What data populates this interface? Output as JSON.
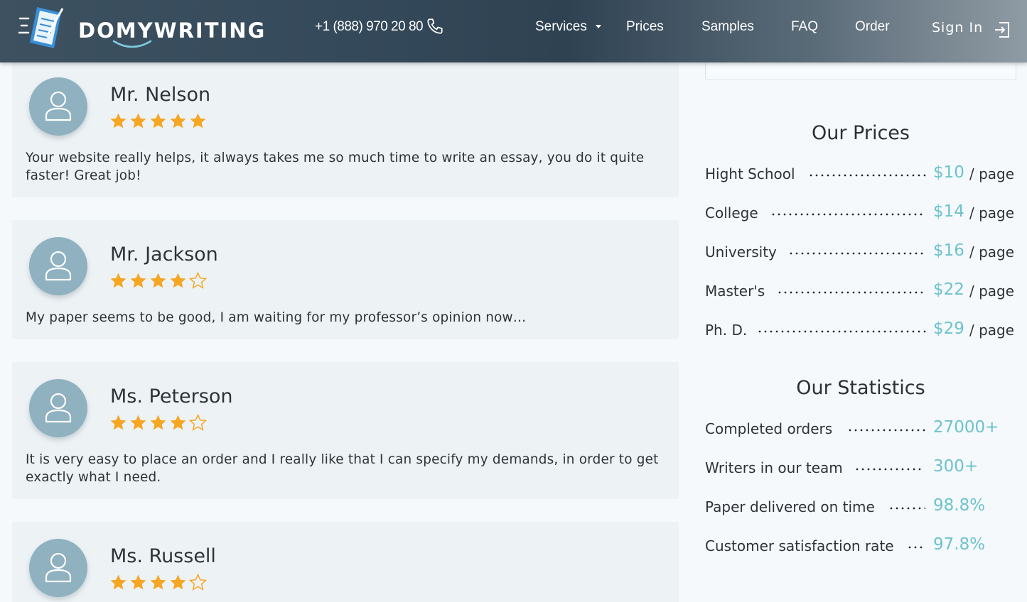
{
  "header": {
    "logo_text": "DOMYWRITING",
    "phone": "+1 (888) 970 20 80",
    "nav": [
      "Services",
      "Prices",
      "Samples",
      "FAQ",
      "Order"
    ],
    "sign_in": "Sign In"
  },
  "reviews": [
    {
      "name": "Mr. Nelson",
      "rating": 5,
      "text": "Your website really helps, it always takes me so much time to write an essay, you do it quite faster! Great job!"
    },
    {
      "name": "Mr. Jackson",
      "rating": 4,
      "text": "My paper seems to be good, I am waiting for my professor’s opinion now…"
    },
    {
      "name": "Ms. Peterson",
      "rating": 4,
      "text": "It is very easy to place an order and I really like that I can specify my demands, in order to get exactly what I need."
    },
    {
      "name": "Ms. Russell",
      "rating": 4,
      "text": ""
    }
  ],
  "prices": {
    "title": "Our Prices",
    "unit": "/ page",
    "rows": [
      {
        "label": "Hight School",
        "value": "$10"
      },
      {
        "label": "College",
        "value": "$14"
      },
      {
        "label": "University",
        "value": "$16"
      },
      {
        "label": "Master's",
        "value": "$22"
      },
      {
        "label": "Ph. D.",
        "value": "$29"
      }
    ]
  },
  "statistics": {
    "title": "Our Statistics",
    "rows": [
      {
        "label": "Completed orders",
        "value": "27000+"
      },
      {
        "label": "Writers in our team",
        "value": "300+"
      },
      {
        "label": "Paper delivered on time",
        "value": "98.8%"
      },
      {
        "label": "Customer satisfaction rate",
        "value": "97.8%"
      }
    ]
  },
  "colors": {
    "accent": "#6cc2cd",
    "star": "#f5a623",
    "avatar": "#8fb1c0",
    "card": "#edf2f5"
  },
  "icons": {
    "logo": "document-pen-icon",
    "phone": "phone-icon",
    "sign_in": "sign-in-icon",
    "avatar": "user-icon",
    "star": "star-icon"
  }
}
